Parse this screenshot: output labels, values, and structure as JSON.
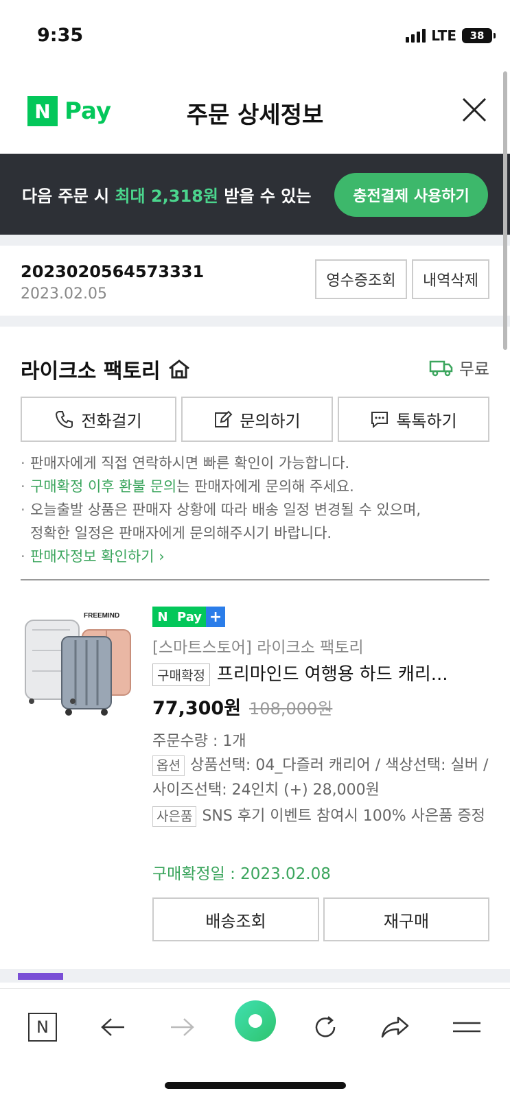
{
  "status_bar": {
    "time": "9:35",
    "network": "LTE",
    "battery": "38"
  },
  "header": {
    "logo_n": "N",
    "logo_pay": "Pay",
    "title": "주문 상세정보"
  },
  "promo": {
    "prefix": "다음 주문 시 ",
    "highlight": "최대 2,318원",
    "suffix": " 받을 수 있는",
    "button": "충전결제 사용하기"
  },
  "order": {
    "number": "2023020564573331",
    "date": "2023.02.05",
    "receipt_button": "영수증조회",
    "delete_button": "내역삭제"
  },
  "seller": {
    "name": "라이크소 팩토리",
    "shipping": "무료",
    "buttons": {
      "call": "전화걸기",
      "inquiry": "문의하기",
      "talk": "톡톡하기"
    },
    "notes": {
      "n1": "판매자에게 직접 연락하시면 빠른 확인이 가능합니다.",
      "n2_green": "구매확정 이후 환불 문의",
      "n2_rest": "는 판매자에게 문의해 주세요.",
      "n3_line1": "오늘출발 상품은 판매자 상황에 따라 배송 일정 변경될 수 있으며,",
      "n3_line2": "정확한 일정은 판매자에게 문의해주시기 바랍니다.",
      "n4": "판매자정보 확인하기"
    }
  },
  "product": {
    "brand_mark": "FREEMIND",
    "badge_n": "N",
    "badge_pay": "Pay",
    "badge_plus": "+",
    "store": "[스마트스토어] 라이크소 팩토리",
    "status_tag": "구매확정",
    "title": "프리마인드 여행용 하드 캐리...",
    "price": "77,300원",
    "original_price": "108,000원",
    "quantity": "주문수량 : 1개",
    "option_tag": "옵션",
    "option_text": "상품선택: 04_다즐러 캐리어 / 색상선택: 실버 / 사이즈선택: 24인치 (+) 28,000원",
    "gift_tag": "사은품",
    "gift_text": "SNS 후기 이벤트 참여시 100% 사은품 증정",
    "confirm_date": "구매확정일 : 2023.02.08",
    "track_button": "배송조회",
    "rebuy_button": "재구매"
  },
  "bottom_nav": {
    "n_label": "N"
  },
  "colors": {
    "brand_green": "#03c75a",
    "promo_bg": "#2d3036",
    "promo_button": "#3db86b",
    "note_green": "#3ba55d"
  }
}
